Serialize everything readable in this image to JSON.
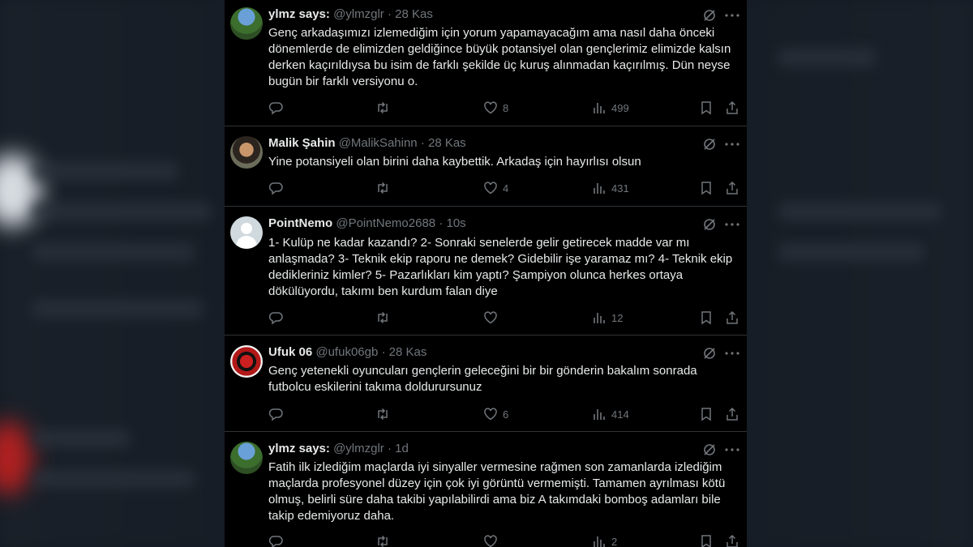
{
  "tweets": [
    {
      "name": "ylmz says:",
      "handle": "@ylmzglr",
      "sep": "·",
      "time": "28 Kas",
      "avatar": "avatar-ylmz",
      "text": "Genç arkadaşımızı izlemediğim için yorum yapamayacağım ama nasıl daha önceki dönemlerde de elimizden geldiğince büyük potansiyel olan gençlerimiz elimizde kalsın derken kaçırıldıysa bu isim de farklı şekilde üç kuruş alınmadan kaçırılmış. Dün neyse bugün bir farklı versiyonu o.",
      "likes": "8",
      "views": "499"
    },
    {
      "name": "Malik Şahin",
      "handle": "@MalikSahinn",
      "sep": "·",
      "time": "28 Kas",
      "avatar": "avatar-malik",
      "text": "Yine potansiyeli olan birini daha kaybettik. Arkadaş için hayırlısı olsun",
      "likes": "4",
      "views": "431"
    },
    {
      "name": "PointNemo",
      "handle": "@PointNemo2688",
      "sep": "·",
      "time": "10s",
      "avatar": "avatar-default",
      "text": "1- Kulüp ne kadar kazandı? 2- Sonraki senelerde gelir getirecek madde var mı anlaşmada? 3- Teknik ekip raporu ne demek? Gidebilir işe yaramaz mı? 4- Teknik ekip dedikleriniz kimler? 5- Pazarlıkları kim yaptı? Şampiyon olunca herkes ortaya dökülüyordu, takımı ben kurdum falan diye",
      "likes": "",
      "views": "12"
    },
    {
      "name": "Ufuk 06",
      "handle": "@ufuk06gb",
      "sep": "·",
      "time": "28 Kas",
      "avatar": "avatar-ufuk",
      "text": "Genç yetenekli oyuncuları gençlerin geleceğini bir bir gönderin bakalım sonrada futbolcu eskilerini takıma doldurursunuz",
      "likes": "6",
      "views": "414"
    },
    {
      "name": "ylmz says:",
      "handle": "@ylmzglr",
      "sep": "·",
      "time": "1d",
      "avatar": "avatar-ylmz",
      "text": "Fatih ilk izlediğim maçlarda iyi sinyaller vermesine rağmen son zamanlarda izlediğim maçlarda profesyonel düzey için çok iyi görüntü vermemişti. Tamamen ayrılması kötü olmuş, belirli süre daha takibi yapılabilirdi ama biz A takımdaki bomboş adamları bile takip edemiyoruz daha.",
      "likes": "",
      "views": "2"
    }
  ],
  "icons": [
    "reply-icon",
    "retweet-icon",
    "like-icon",
    "views-icon",
    "bookmark-icon",
    "share-icon",
    "grok-icon",
    "more-icon"
  ],
  "colors": {
    "background": "#000000",
    "text": "#e7e9ea",
    "muted": "#71767b",
    "divider": "#2f3336"
  }
}
